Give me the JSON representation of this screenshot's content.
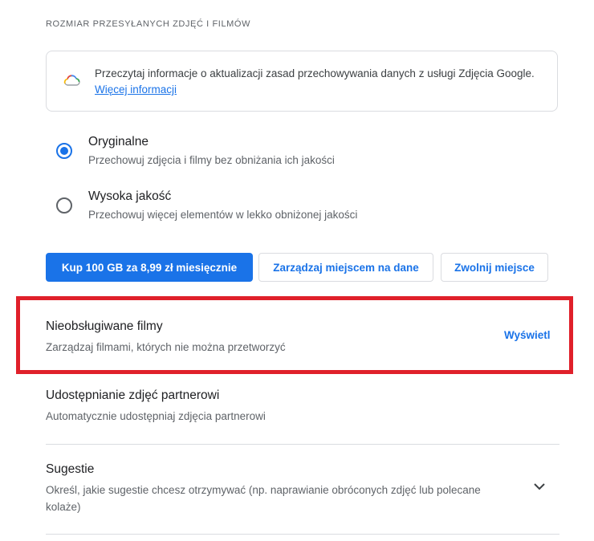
{
  "section": {
    "title": "ROZMIAR PRZESYŁANYCH ZDJĘĆ I FILMÓW"
  },
  "info_card": {
    "text": "Przeczytaj informacje o aktualizacji zasad przechowywania danych z usługi Zdjęcia Google. ",
    "link": "Więcej informacji"
  },
  "options": [
    {
      "title": "Oryginalne",
      "subtitle": "Przechowuj zdjęcia i filmy bez obniżania ich jakości",
      "selected": true
    },
    {
      "title": "Wysoka jakość",
      "subtitle": "Przechowuj więcej elementów w lekko obniżonej jakości",
      "selected": false
    }
  ],
  "buttons": {
    "buy": "Kup 100 GB za 8,99 zł miesięcznie",
    "manage": "Zarządzaj miejscem na dane",
    "free": "Zwolnij miejsce"
  },
  "unsupported": {
    "title": "Nieobsługiwane filmy",
    "subtitle": "Zarządzaj filmami, których nie można przetworzyć",
    "action": "Wyświetl"
  },
  "partner": {
    "title": "Udostępnianie zdjęć partnerowi",
    "subtitle": "Automatycznie udostępniaj zdjęcia partnerowi"
  },
  "suggestions": {
    "title": "Sugestie",
    "subtitle": "Określ, jakie sugestie chcesz otrzymywać (np. naprawianie obróconych zdjęć lub polecane kolaże)"
  },
  "colors": {
    "accent": "#1a73e8",
    "highlight": "#e0202a",
    "divider": "#dadce0"
  },
  "icons": {
    "cloud": "google-cloud-icon",
    "chevron": "chevron-down-icon"
  }
}
